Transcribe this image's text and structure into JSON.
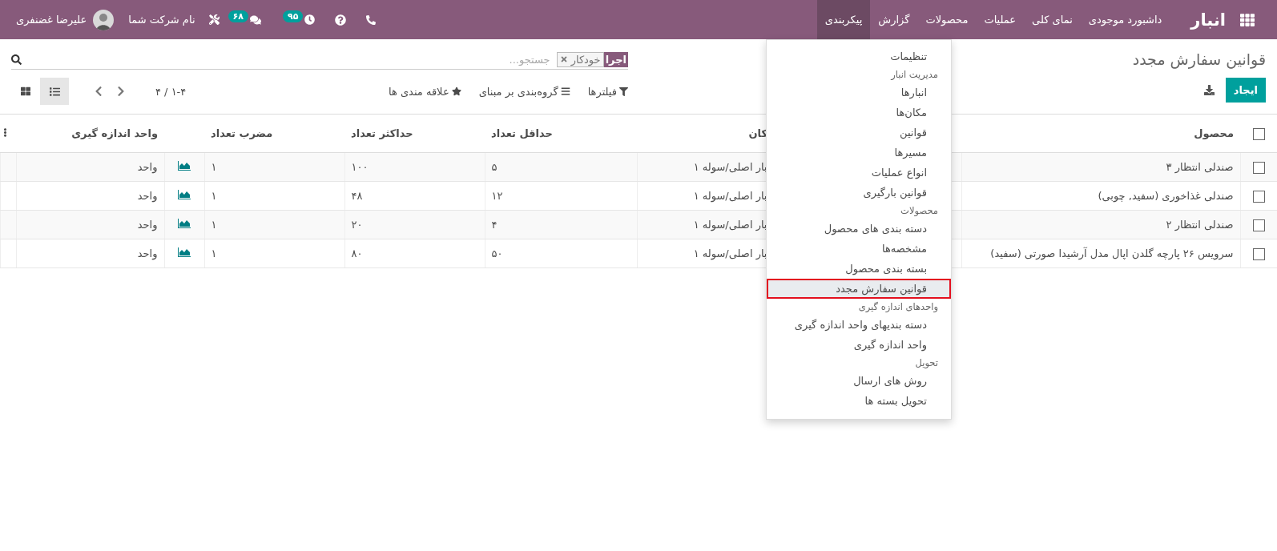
{
  "top_bar": {
    "app_name": "انبار",
    "menu": [
      {
        "label": "داشبورد موجودی",
        "selected": false
      },
      {
        "label": "نمای کلی",
        "selected": false
      },
      {
        "label": "عملیات",
        "selected": false
      },
      {
        "label": "محصولات",
        "selected": false
      },
      {
        "label": "گزارش",
        "selected": false
      },
      {
        "label": "پیکربندی",
        "selected": true
      }
    ],
    "activity_count": "۹۵",
    "message_count": "۶۸",
    "company": "نام شرکت شما",
    "user": "علیرضا غضنفری"
  },
  "dropdown": {
    "items": [
      {
        "kind": "item",
        "label": "تنظیمات",
        "selected": false
      },
      {
        "kind": "header",
        "label": "مدیریت انبار"
      },
      {
        "kind": "item",
        "label": "انبارها",
        "selected": false
      },
      {
        "kind": "item",
        "label": "مکان‌ها",
        "selected": false
      },
      {
        "kind": "item",
        "label": "قوانین",
        "selected": false
      },
      {
        "kind": "item",
        "label": "مسیرها",
        "selected": false
      },
      {
        "kind": "item",
        "label": "انواع عملیات",
        "selected": false
      },
      {
        "kind": "item",
        "label": "قوانین بارگیری",
        "selected": false
      },
      {
        "kind": "header",
        "label": "محصولات"
      },
      {
        "kind": "item",
        "label": "دسته بندی های محصول",
        "selected": false
      },
      {
        "kind": "item",
        "label": "مشخصه‌ها",
        "selected": false
      },
      {
        "kind": "item",
        "label": "بسته بندی محصول",
        "selected": false
      },
      {
        "kind": "item",
        "label": "قوانین سفارش مجدد",
        "selected": true
      },
      {
        "kind": "header",
        "label": "واحدهای اندازه گیری"
      },
      {
        "kind": "item",
        "label": "دسته بندیهای واحد اندازه گیری",
        "selected": false
      },
      {
        "kind": "item",
        "label": "واحد اندازه گیری",
        "selected": false
      },
      {
        "kind": "header",
        "label": "تحویل"
      },
      {
        "kind": "item",
        "label": "روش های ارسال",
        "selected": false
      },
      {
        "kind": "item",
        "label": "تحویل بسته ها",
        "selected": false
      }
    ]
  },
  "breadcrumb": "قوانین سفارش مجدد",
  "create_button": "ایجاد",
  "search": {
    "facet_label": "اجرا",
    "facet_value": "خودکار",
    "placeholder": "جستجو..."
  },
  "filters": [
    {
      "kind": "filter",
      "label": "فیلترها"
    },
    {
      "kind": "group",
      "label": "گروه‌بندی بر مبنای"
    },
    {
      "kind": "favorite",
      "label": "علاقه مندی ها"
    }
  ],
  "pager": "۱-۴ / ۴",
  "views": [
    {
      "kind": "list",
      "selected": true
    },
    {
      "kind": "kanban",
      "selected": false
    }
  ],
  "table": {
    "header_checked": false,
    "columns": [
      {
        "label": "محصول",
        "kind": "text"
      },
      {
        "label": "کان",
        "kind": "location"
      },
      {
        "label": "حداقل تعداد",
        "kind": "number"
      },
      {
        "label": "حداکثر تعداد",
        "kind": "number"
      },
      {
        "label": "مضرب تعداد",
        "kind": "number"
      },
      {
        "label": "واحد اندازه گیری",
        "kind": "unit"
      }
    ],
    "rows": [
      {
        "checked": false,
        "cells": [
          "صندلی انتظار ۳",
          "بار اصلی/سوله ۱",
          "۵",
          "۱۰۰",
          "۱",
          "واحد"
        ]
      },
      {
        "checked": false,
        "cells": [
          "صندلی غذاخوری (سفید, چوبی)",
          "بار اصلی/سوله ۱",
          "۱۲",
          "۴۸",
          "۱",
          "واحد"
        ]
      },
      {
        "checked": false,
        "cells": [
          "صندلی انتظار ۲",
          "بار اصلی/سوله ۱",
          "۴",
          "۲۰",
          "۱",
          "واحد"
        ]
      },
      {
        "checked": false,
        "cells": [
          "سرویس ۲۶ پارچه گلدن اپال مدل آرشیدا صورتی (سفید)",
          "بار اصلی/سوله ۱",
          "۵۰",
          "۸۰",
          "۱",
          "واحد"
        ]
      }
    ]
  }
}
